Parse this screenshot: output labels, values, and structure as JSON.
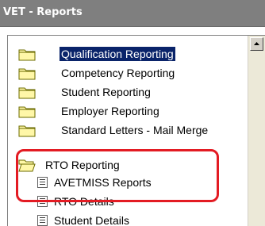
{
  "window": {
    "title": "VET - Reports"
  },
  "tree": {
    "items": [
      {
        "label": "Qualification Reporting",
        "icon": "folder-closed-icon",
        "selected": true
      },
      {
        "label": "Competency Reporting",
        "icon": "folder-closed-icon",
        "selected": false
      },
      {
        "label": "Student Reporting",
        "icon": "folder-closed-icon",
        "selected": false
      },
      {
        "label": "Employer Reporting",
        "icon": "folder-closed-icon",
        "selected": false
      },
      {
        "label": "Standard Letters - Mail Merge",
        "icon": "folder-closed-icon",
        "selected": false
      },
      {
        "label": "RTO Reporting",
        "icon": "folder-open-icon",
        "selected": false
      },
      {
        "label": "AVETMISS Reports",
        "icon": "report-icon",
        "selected": false
      },
      {
        "label": "RTO Details",
        "icon": "report-icon",
        "selected": false
      },
      {
        "label": "Student Details",
        "icon": "report-icon",
        "selected": false
      }
    ]
  },
  "colors": {
    "title_bar": "#7f7f7f",
    "selection": "#0a246a",
    "folder_fill": "#fff7a8",
    "folder_stroke": "#6b6b00",
    "highlight": "#e31b23"
  }
}
